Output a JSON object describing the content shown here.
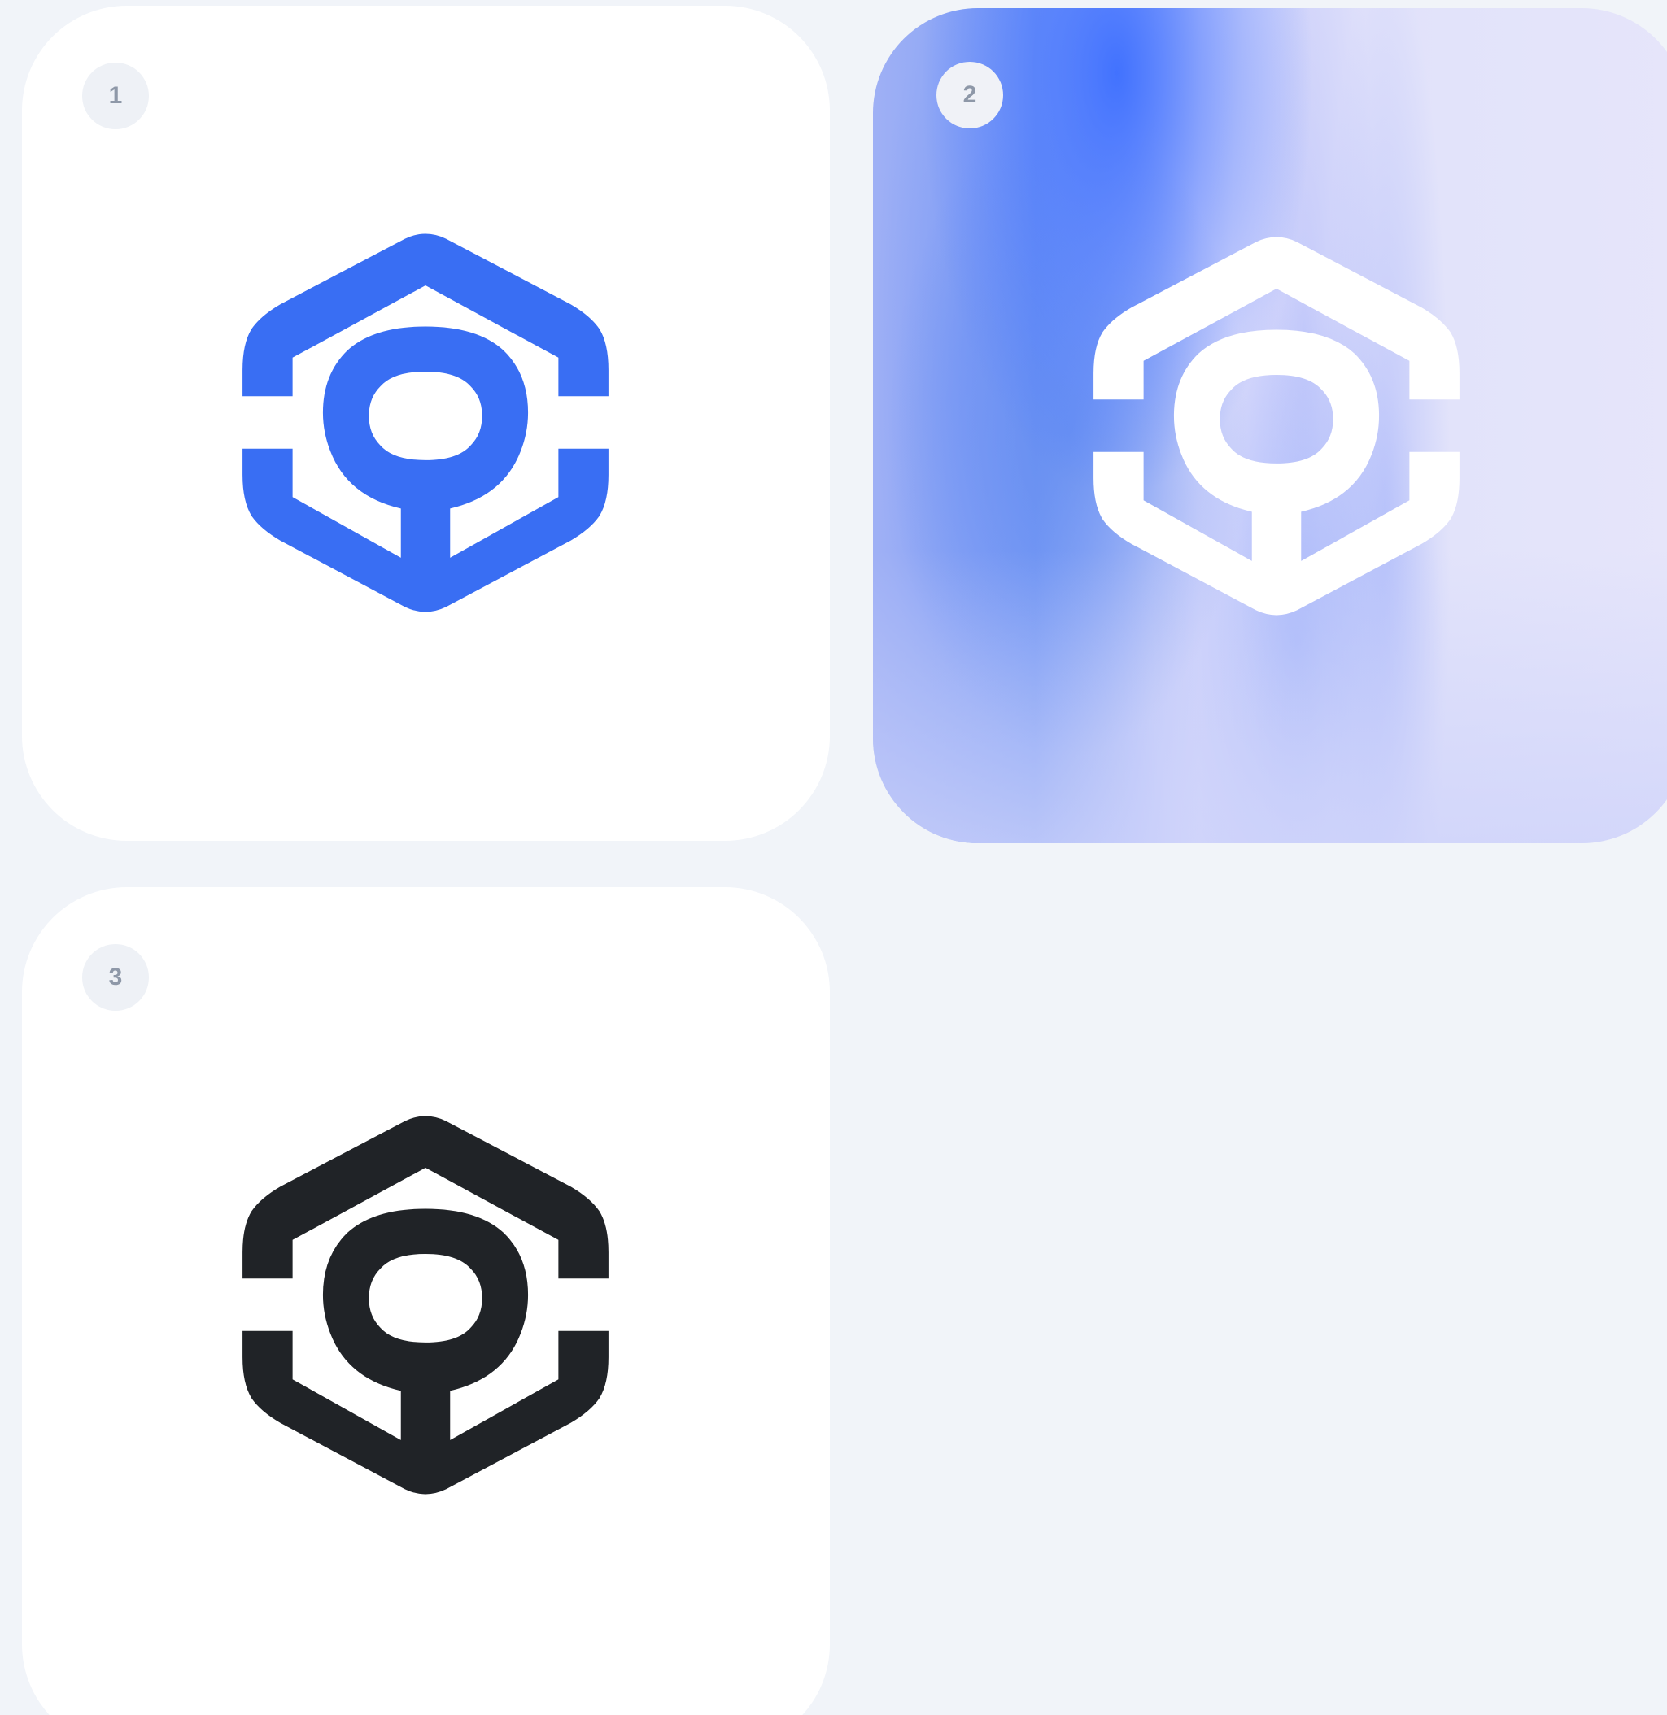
{
  "cards": [
    {
      "number": "1",
      "logo_color": "#396ef3",
      "background": "white"
    },
    {
      "number": "2",
      "logo_color": "#ffffff",
      "background": "blue-gradient"
    },
    {
      "number": "3",
      "logo_color": "#202327",
      "background": "white"
    }
  ],
  "logo_icon": "hexagon-keyhole-logo-icon"
}
